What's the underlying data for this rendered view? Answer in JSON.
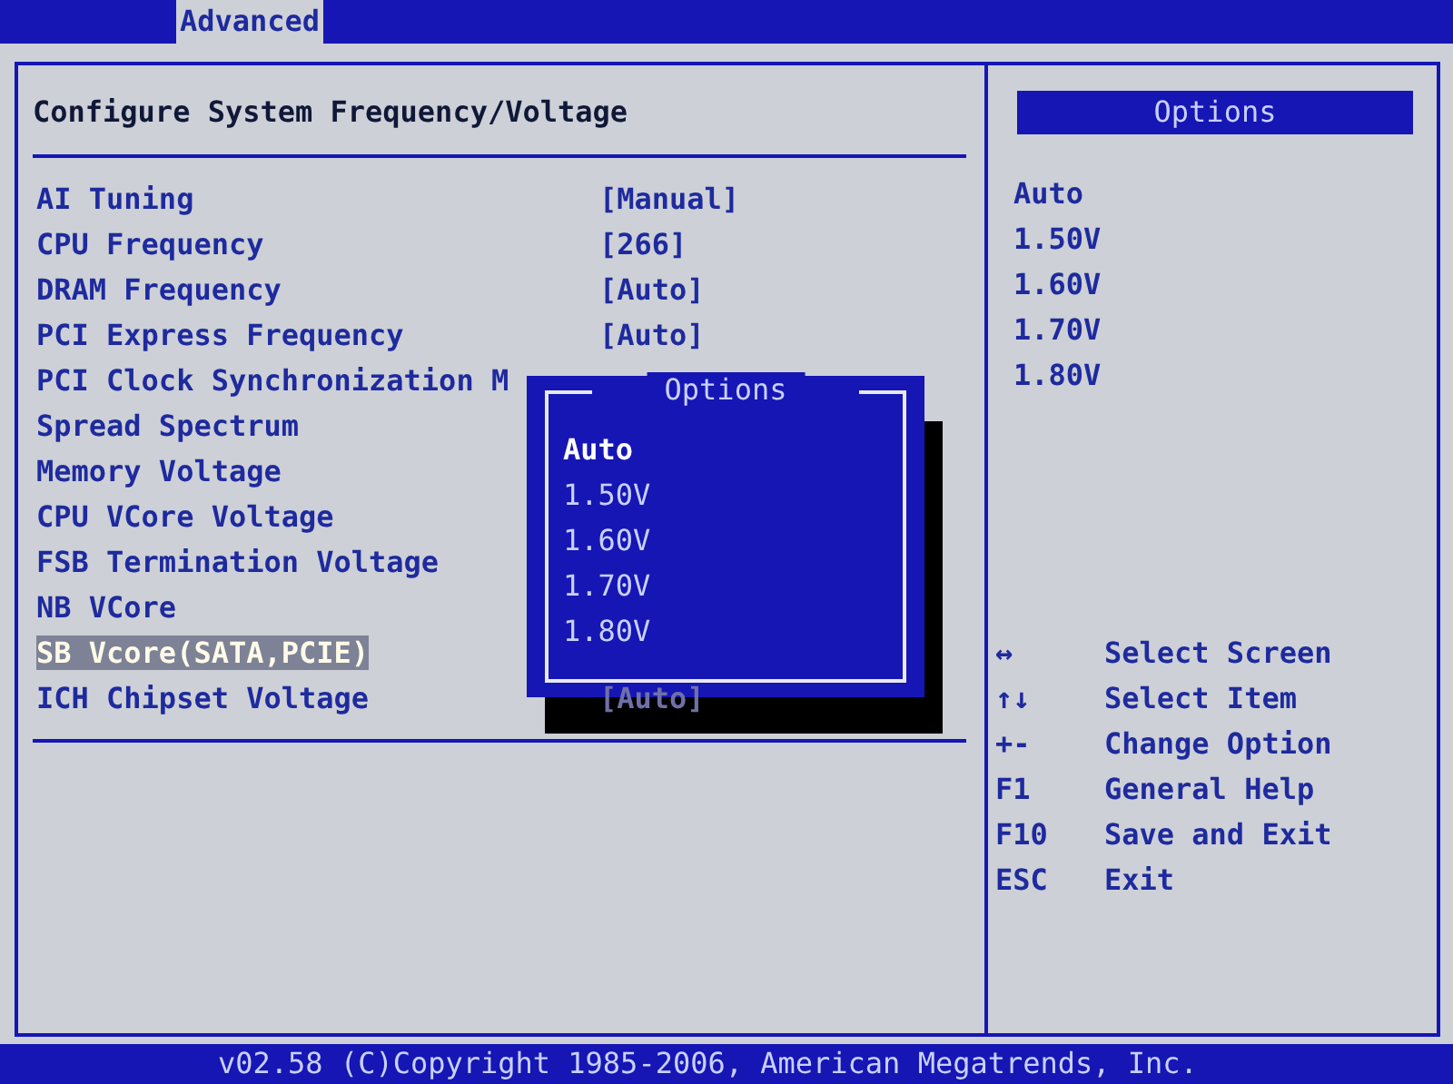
{
  "menu_bar": {
    "tabs": [
      {
        "label": "Advanced",
        "selected": true
      }
    ]
  },
  "main": {
    "title": "Configure System Frequency/Voltage",
    "settings": [
      {
        "label": "AI Tuning",
        "value": "[Manual]",
        "selected": false
      },
      {
        "label": "CPU Frequency",
        "value": "[266]",
        "selected": false
      },
      {
        "label": "DRAM Frequency",
        "value": "[Auto]",
        "selected": false
      },
      {
        "label": "PCI Express Frequency",
        "value": "[Auto]",
        "selected": false
      },
      {
        "label": "PCI Clock Synchronization M",
        "selected": false
      },
      {
        "label": "Spread Spectrum",
        "selected": false
      },
      {
        "label": "Memory Voltage",
        "selected": false
      },
      {
        "label": "CPU VCore Voltage",
        "selected": false
      },
      {
        "label": "FSB Termination Voltage",
        "selected": false
      },
      {
        "label": "NB VCore",
        "selected": false
      },
      {
        "label": "SB Vcore(SATA,PCIE)",
        "selected": true
      },
      {
        "label": "ICH Chipset Voltage",
        "value": "[Auto]",
        "selected": false,
        "dimmed": true
      }
    ],
    "popup": {
      "title": "Options",
      "options": [
        {
          "label": "Auto",
          "selected": true
        },
        {
          "label": "1.50V",
          "selected": false
        },
        {
          "label": "1.60V",
          "selected": false
        },
        {
          "label": "1.70V",
          "selected": false
        },
        {
          "label": "1.80V",
          "selected": false
        }
      ]
    }
  },
  "help_panel": {
    "title": "Options",
    "options": [
      "Auto",
      "1.50V",
      "1.60V",
      "1.70V",
      "1.80V"
    ],
    "keys": [
      {
        "key": "↔",
        "action": "Select Screen"
      },
      {
        "key": "↑↓",
        "action": "Select Item"
      },
      {
        "key": "+-",
        "action": "Change Option"
      },
      {
        "key": "F1",
        "action": "General Help"
      },
      {
        "key": "F10",
        "action": "Save and Exit"
      },
      {
        "key": "ESC",
        "action": "Exit"
      }
    ]
  },
  "footer": "v02.58 (C)Copyright 1985-2006, American Megatrends, Inc."
}
